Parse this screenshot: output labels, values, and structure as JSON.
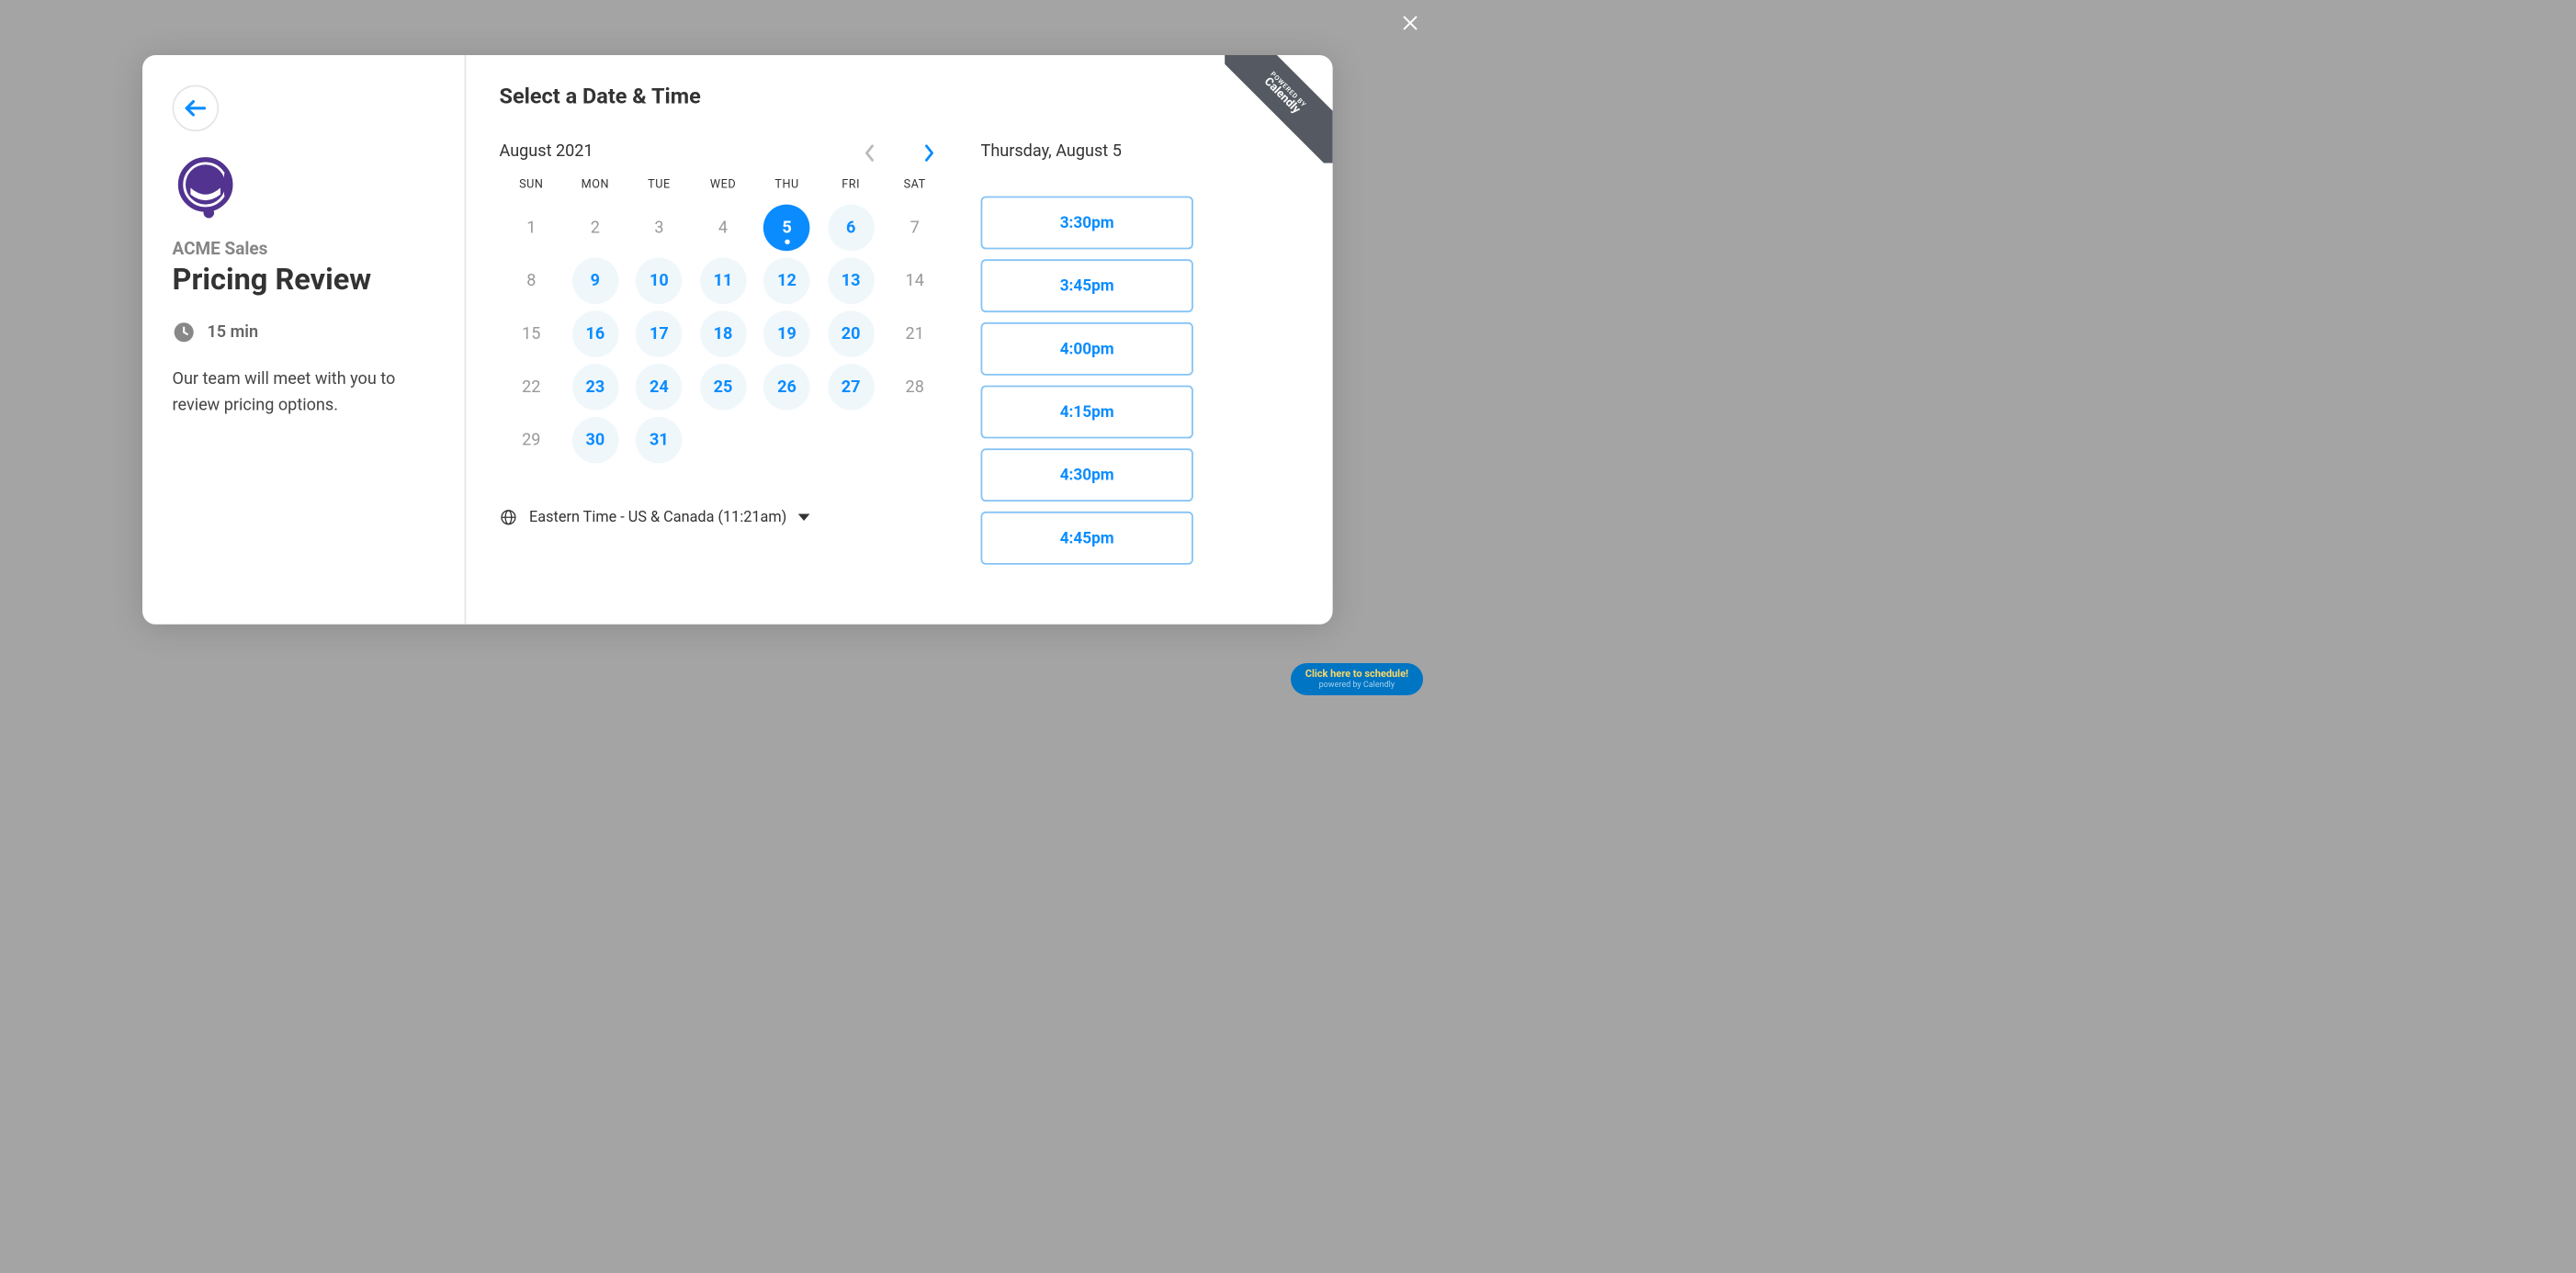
{
  "close_label": "Close",
  "powered_by": {
    "line1": "POWERED BY",
    "line2": "Calendly"
  },
  "left": {
    "org": "ACME Sales",
    "event_title": "Pricing Review",
    "duration": "15 min",
    "description": "Our team will meet with you to review pricing options."
  },
  "right": {
    "title": "Select a Date & Time",
    "month_label": "August 2021",
    "weekdays": [
      "SUN",
      "MON",
      "TUE",
      "WED",
      "THU",
      "FRI",
      "SAT"
    ],
    "days": [
      {
        "n": "1",
        "state": "disabled"
      },
      {
        "n": "2",
        "state": "disabled"
      },
      {
        "n": "3",
        "state": "disabled"
      },
      {
        "n": "4",
        "state": "disabled"
      },
      {
        "n": "5",
        "state": "selected"
      },
      {
        "n": "6",
        "state": "available"
      },
      {
        "n": "7",
        "state": "disabled"
      },
      {
        "n": "8",
        "state": "disabled"
      },
      {
        "n": "9",
        "state": "available"
      },
      {
        "n": "10",
        "state": "available"
      },
      {
        "n": "11",
        "state": "available"
      },
      {
        "n": "12",
        "state": "available"
      },
      {
        "n": "13",
        "state": "available"
      },
      {
        "n": "14",
        "state": "disabled"
      },
      {
        "n": "15",
        "state": "disabled"
      },
      {
        "n": "16",
        "state": "available"
      },
      {
        "n": "17",
        "state": "available"
      },
      {
        "n": "18",
        "state": "available"
      },
      {
        "n": "19",
        "state": "available"
      },
      {
        "n": "20",
        "state": "available"
      },
      {
        "n": "21",
        "state": "disabled"
      },
      {
        "n": "22",
        "state": "disabled"
      },
      {
        "n": "23",
        "state": "available"
      },
      {
        "n": "24",
        "state": "available"
      },
      {
        "n": "25",
        "state": "available"
      },
      {
        "n": "26",
        "state": "available"
      },
      {
        "n": "27",
        "state": "available"
      },
      {
        "n": "28",
        "state": "disabled"
      },
      {
        "n": "29",
        "state": "disabled"
      },
      {
        "n": "30",
        "state": "available"
      },
      {
        "n": "31",
        "state": "available"
      }
    ],
    "timezone": "Eastern Time - US & Canada (11:21am)",
    "selected_date": "Thursday, August 5",
    "time_slots": [
      "3:30pm",
      "3:45pm",
      "4:00pm",
      "4:15pm",
      "4:30pm",
      "4:45pm"
    ]
  },
  "pill": {
    "line1": "Click here to schedule!",
    "line2": "powered by Calendly"
  }
}
